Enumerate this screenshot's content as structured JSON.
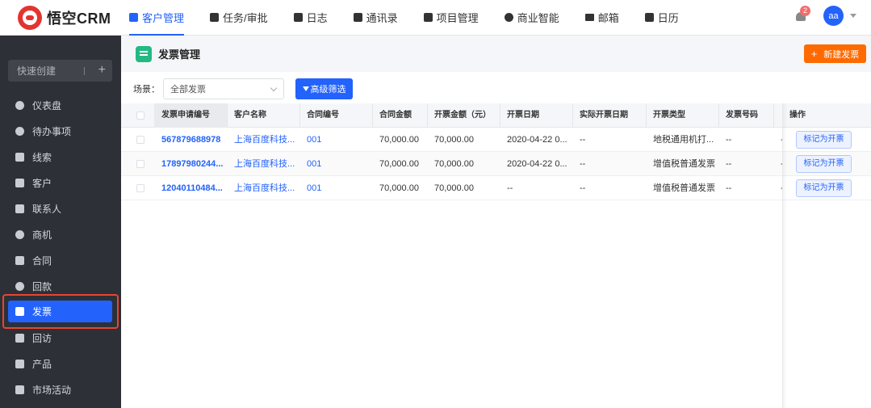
{
  "brand": {
    "name": "悟空CRM"
  },
  "nav": [
    {
      "label": "客户管理",
      "icon": "customer-icon",
      "active": true
    },
    {
      "label": "任务/审批",
      "icon": "briefcase-icon"
    },
    {
      "label": "日志",
      "icon": "log-icon"
    },
    {
      "label": "通讯录",
      "icon": "contacts-icon"
    },
    {
      "label": "项目管理",
      "icon": "project-icon"
    },
    {
      "label": "商业智能",
      "icon": "shield-check-icon"
    },
    {
      "label": "邮箱",
      "icon": "mail-icon"
    },
    {
      "label": "日历",
      "icon": "calendar-icon"
    }
  ],
  "topright": {
    "notification_count": "2",
    "avatar_text": "aa"
  },
  "sidebar": {
    "quick_create": "快速创建",
    "items": [
      {
        "label": "仪表盘",
        "icon": "dashboard-icon"
      },
      {
        "label": "待办事项",
        "icon": "chat-icon"
      },
      {
        "label": "线索",
        "icon": "leads-icon"
      },
      {
        "label": "客户",
        "icon": "building-icon"
      },
      {
        "label": "联系人",
        "icon": "contact-card-icon"
      },
      {
        "label": "商机",
        "icon": "dollar-icon"
      },
      {
        "label": "合同",
        "icon": "contract-icon"
      },
      {
        "label": "回款",
        "icon": "moneybag-icon"
      },
      {
        "label": "发票",
        "icon": "invoice-icon",
        "active": true
      },
      {
        "label": "回访",
        "icon": "home-icon"
      },
      {
        "label": "产品",
        "icon": "box-icon"
      },
      {
        "label": "市场活动",
        "icon": "send-icon"
      }
    ]
  },
  "page": {
    "title": "发票管理",
    "new_button": "新建发票",
    "scene_label": "场景：",
    "scene_value": "全部发票",
    "advanced_filter": "高级筛选"
  },
  "table": {
    "columns": [
      "发票申请编号",
      "客户名称",
      "合同编号",
      "合同金额",
      "开票金额（元）",
      "开票日期",
      "实际开票日期",
      "开票类型",
      "发票号码",
      "",
      "操作"
    ],
    "rows": [
      {
        "invoice_no": "567879688978",
        "customer": "上海百度科技...",
        "contract_no": "001",
        "contract_amount": "70,000.00",
        "invoice_amount": "70,000.00",
        "invoice_date": "2020-04-22 0...",
        "actual_date": "--",
        "invoice_type": "地税通用机打...",
        "invoice_number": "--",
        "extra": "-",
        "action": "标记为开票"
      },
      {
        "invoice_no": "17897980244...",
        "customer": "上海百度科技...",
        "contract_no": "001",
        "contract_amount": "70,000.00",
        "invoice_amount": "70,000.00",
        "invoice_date": "2020-04-22 0...",
        "actual_date": "--",
        "invoice_type": "增值税普通发票",
        "invoice_number": "--",
        "extra": "-",
        "action": "标记为开票"
      },
      {
        "invoice_no": "12040110484...",
        "customer": "上海百度科技...",
        "contract_no": "001",
        "contract_amount": "70,000.00",
        "invoice_amount": "70,000.00",
        "invoice_date": "--",
        "actual_date": "--",
        "invoice_type": "增值税普通发票",
        "invoice_number": "--",
        "extra": "-",
        "action": "标记为开票"
      }
    ]
  },
  "colors": {
    "primary": "#2362fb",
    "orange": "#ff6a00",
    "sidebar_bg": "#2d3037",
    "highlight": "#e8452f"
  }
}
